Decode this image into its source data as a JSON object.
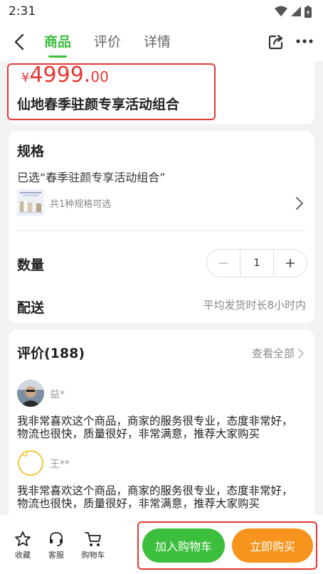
{
  "status": {
    "time": "2:31"
  },
  "nav": {
    "tabs": [
      {
        "label": "商品",
        "active": true
      },
      {
        "label": "评价",
        "active": false
      },
      {
        "label": "详情",
        "active": false
      }
    ]
  },
  "product": {
    "currency": "¥",
    "price_int": "4999.",
    "price_dec": "00",
    "title": "仙地春季驻颜专享活动组合"
  },
  "spec": {
    "heading": "规格",
    "selected": "已选“春季驻颜专享活动组合”",
    "count_text": "共1种规格可选"
  },
  "quantity": {
    "label": "数量",
    "value": "1",
    "minus": "−",
    "plus": "+"
  },
  "delivery": {
    "label": "配送",
    "value": "平均发货时长8小时内"
  },
  "reviews": {
    "heading": "评价(188)",
    "view_all": "查看全部",
    "items": [
      {
        "name": "益*",
        "text": "我非常喜欢这个商品，商家的服务很专业，态度非常好，物流也很快，质量很好，非常满意，推荐大家购买"
      },
      {
        "name": "王**",
        "text": "我非常喜欢这个商品，商家的服务很专业，态度非常好，物流也很快，质量很好，非常满意，推荐大家购买"
      }
    ]
  },
  "bottom": {
    "favorite": "收藏",
    "service": "客服",
    "cart": "购物车",
    "add_to_cart": "加入购物车",
    "buy_now": "立即购买"
  },
  "colors": {
    "accent": "#3cbf3c",
    "price": "#e53935",
    "buy": "#f7941d",
    "highlight": "#e53935"
  }
}
